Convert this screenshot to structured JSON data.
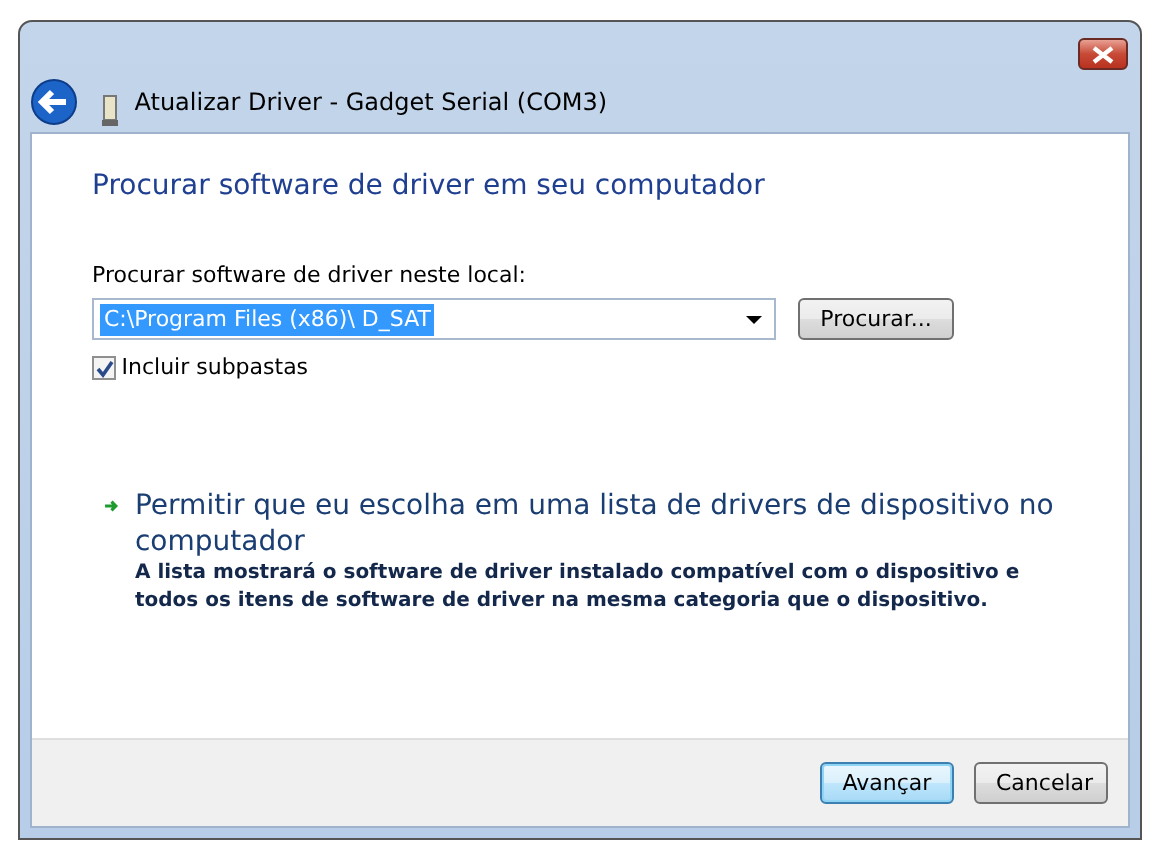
{
  "window": {
    "title": "Atualizar Driver -  Gadget Serial (COM3)"
  },
  "heading": "Procurar software de driver em seu computador",
  "location": {
    "label": "Procurar software de driver neste local:",
    "value": "C:\\Program Files (x86)\\ D_SAT",
    "browse_button": "Procurar..."
  },
  "include_subfolders": {
    "label": "Incluir subpastas",
    "checked": true
  },
  "option": {
    "title": "Permitir que eu escolha em uma lista de drivers de dispositivo no computador",
    "description": "A lista mostrará o software de driver instalado compatível com o dispositivo e todos os itens de software de driver na mesma categoria que o dispositivo."
  },
  "buttons": [
    {
      "label": "Avançar",
      "selected": true
    },
    {
      "label": "Cancelar",
      "selected": false
    }
  ]
}
